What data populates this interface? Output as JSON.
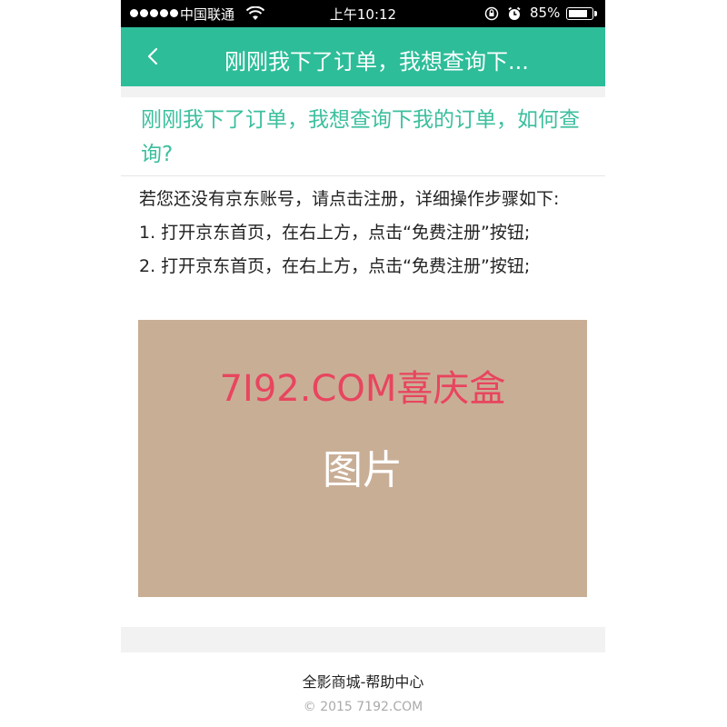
{
  "status_bar": {
    "carrier": "中国联通",
    "time": "上午10:12",
    "battery": "85%",
    "battery_level": 0.85,
    "icons": [
      "signal-dots-icon",
      "wifi-icon",
      "rotation-lock-icon",
      "alarm-icon",
      "battery-icon"
    ]
  },
  "nav": {
    "back_icon": "chevron-left-icon",
    "title": "刚刚我下了订单，我想查询下..."
  },
  "question": {
    "title": "刚刚我下了订单，我想查询下我的订单，如何查询?"
  },
  "answer": {
    "intro": "若您还没有京东账号，请点击注册，详细操作步骤如下:",
    "steps": [
      "1. 打开京东首页，在右上方，点击“免费注册”按钮;",
      "2. 打开京东首页，在右上方，点击“免费注册”按钮;"
    ],
    "image": {
      "watermark": "7I92.COM喜庆盒",
      "label": "图片"
    }
  },
  "footer": {
    "title": "全影商城-帮助中心",
    "copyright": "©  2015 7192.COM"
  },
  "colors": {
    "accent": "#2dbd99",
    "title_text": "#3cbf9e",
    "image_bg": "#c9ae96",
    "watermark": "#e8455f",
    "page_gray": "#f2f2f2"
  }
}
